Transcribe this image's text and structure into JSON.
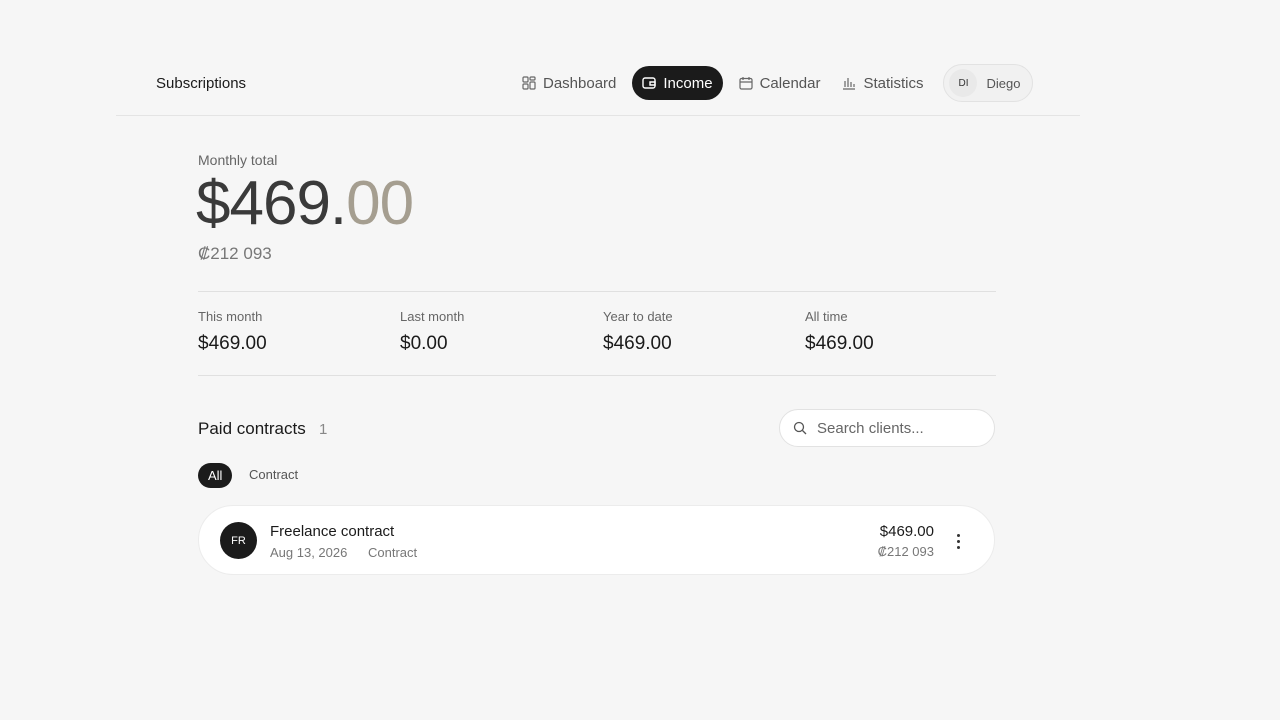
{
  "header": {
    "brand": "Subscriptions",
    "nav": [
      {
        "label": "Dashboard",
        "icon": "grid-icon"
      },
      {
        "label": "Income",
        "icon": "wallet-icon",
        "active": true
      },
      {
        "label": "Calendar",
        "icon": "calendar-icon"
      },
      {
        "label": "Statistics",
        "icon": "bar-chart-icon"
      }
    ],
    "user": {
      "initials": "DI",
      "name": "Diego"
    }
  },
  "summary": {
    "label": "Monthly total",
    "amount_main": "$469.",
    "amount_cents": "00",
    "secondary": "₡212 093"
  },
  "stats": [
    {
      "label": "This month",
      "value": "$469.00"
    },
    {
      "label": "Last month",
      "value": "$0.00"
    },
    {
      "label": "Year to date",
      "value": "$469.00"
    },
    {
      "label": "All time",
      "value": "$469.00"
    }
  ],
  "contracts": {
    "title": "Paid contracts",
    "count": "1",
    "search_placeholder": "Search clients...",
    "filters": [
      "All",
      "Contract"
    ],
    "items": [
      {
        "initials": "FR",
        "name": "Freelance contract",
        "date": "Aug 13, 2026",
        "type": "Contract",
        "amount": "$469.00",
        "amount_secondary": "₡212 093"
      }
    ]
  },
  "colors": {
    "background": "#f6f6f6",
    "accent_dark": "#1b1b1b",
    "cents_tint": "#a59e90"
  }
}
